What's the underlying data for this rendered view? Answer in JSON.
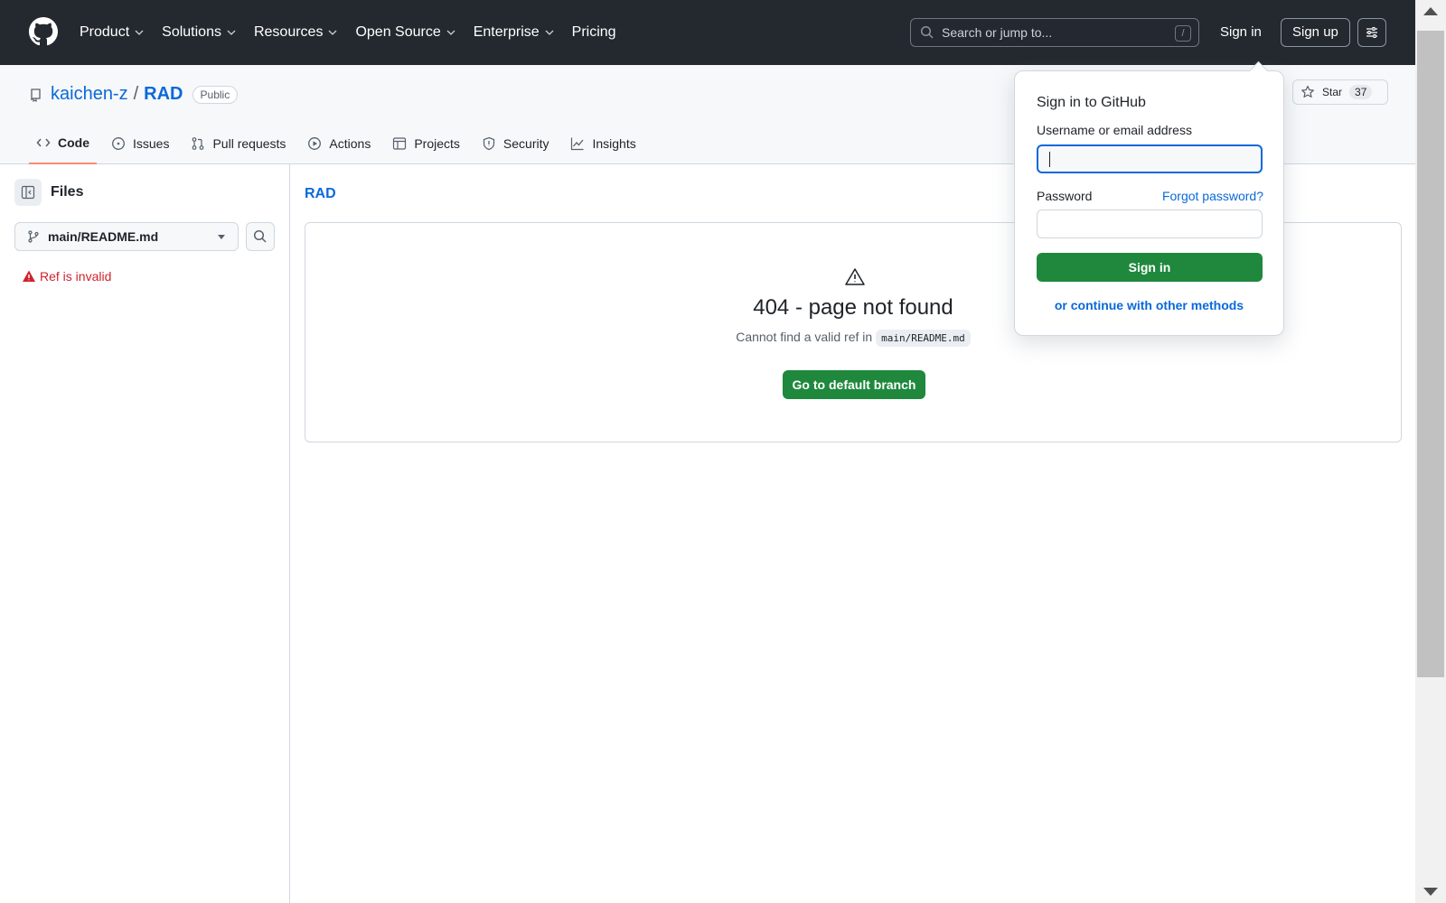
{
  "header": {
    "nav": [
      {
        "label": "Product",
        "has_menu": true
      },
      {
        "label": "Solutions",
        "has_menu": true
      },
      {
        "label": "Resources",
        "has_menu": true
      },
      {
        "label": "Open Source",
        "has_menu": true
      },
      {
        "label": "Enterprise",
        "has_menu": true
      },
      {
        "label": "Pricing",
        "has_menu": false
      }
    ],
    "search_placeholder": "Search or jump to...",
    "search_shortcut": "/",
    "sign_in": "Sign in",
    "sign_up": "Sign up"
  },
  "repo": {
    "owner": "kaichen-z",
    "separator": "/",
    "name": "RAD",
    "visibility": "Public",
    "star_label": "Star",
    "star_count": "37",
    "tabs": [
      {
        "label": "Code",
        "icon": "code-icon",
        "active": true
      },
      {
        "label": "Issues",
        "icon": "issue-icon",
        "active": false
      },
      {
        "label": "Pull requests",
        "icon": "pull-request-icon",
        "active": false
      },
      {
        "label": "Actions",
        "icon": "play-icon",
        "active": false
      },
      {
        "label": "Projects",
        "icon": "table-icon",
        "active": false
      },
      {
        "label": "Security",
        "icon": "shield-icon",
        "active": false
      },
      {
        "label": "Insights",
        "icon": "graph-icon",
        "active": false
      }
    ]
  },
  "sidebar": {
    "title": "Files",
    "branch": "main/README.md",
    "error": "Ref is invalid"
  },
  "main": {
    "breadcrumb": "RAD",
    "title": "404 - page not found",
    "subtitle_prefix": "Cannot find a valid ref in",
    "ref": "main/README.md",
    "button": "Go to default branch"
  },
  "signin_popover": {
    "title": "Sign in to GitHub",
    "username_label": "Username or email address",
    "username_value": "",
    "password_label": "Password",
    "forgot": "Forgot password?",
    "submit": "Sign in",
    "other": "or continue with other methods"
  },
  "colors": {
    "header_bg": "#24292f",
    "link": "#0969da",
    "primary_button": "#1f883d",
    "danger": "#cf222e",
    "active_tab_underline": "#fd8c73"
  }
}
